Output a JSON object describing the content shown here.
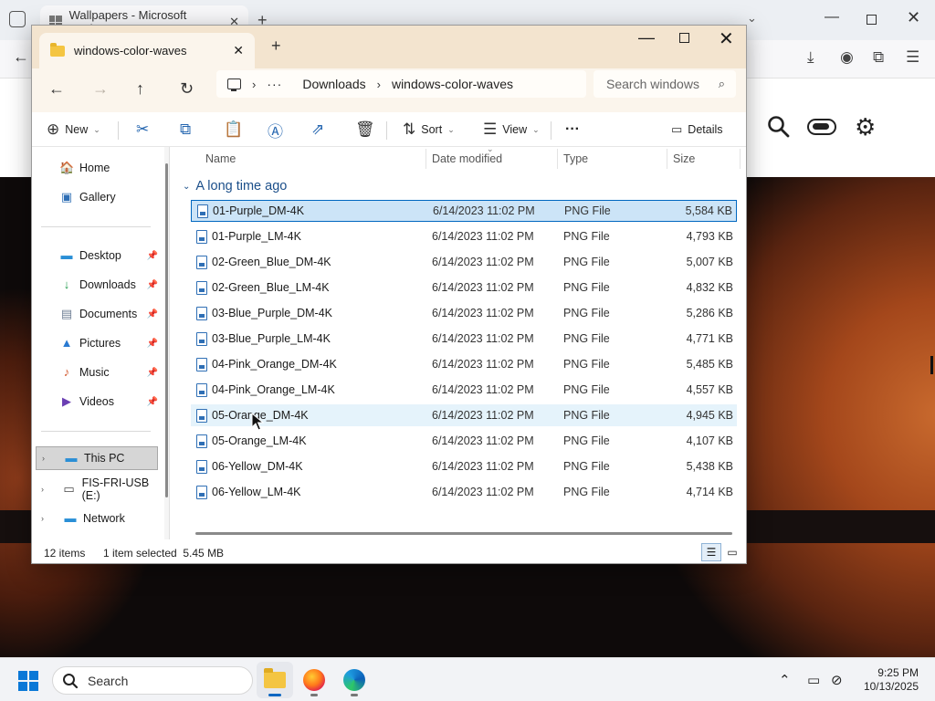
{
  "browser": {
    "tab_title": "Wallpapers - Microsoft Design",
    "tab_close": "✕",
    "new_tab": "+",
    "back": "←",
    "toolbar_icons": {
      "downloads": "download-icon",
      "account": "account-icon",
      "extensions": "extensions-icon",
      "menu": "menu-icon"
    }
  },
  "explorer": {
    "tab_title": "windows-color-waves",
    "tab_close": "✕",
    "new_tab": "+",
    "window_min": "—",
    "window_close": "✕",
    "nav": {
      "back": "←",
      "forward": "→",
      "up": "↑",
      "refresh": "↻"
    },
    "address": {
      "more": "···",
      "crumbs": [
        "Downloads",
        "windows-color-waves"
      ],
      "sep": "›"
    },
    "search_placeholder": "Search windows",
    "commands": {
      "new": "New",
      "sort": "Sort",
      "view": "View",
      "more": "···",
      "details": "Details"
    },
    "sidebar": {
      "home": "Home",
      "gallery": "Gallery",
      "pinned": [
        "Desktop",
        "Downloads",
        "Documents",
        "Pictures",
        "Music",
        "Videos"
      ],
      "this_pc": "This PC",
      "usb": "FIS-FRI-USB (E:)",
      "network": "Network"
    },
    "columns": {
      "name": "Name",
      "date": "Date modified",
      "type": "Type",
      "size": "Size"
    },
    "group": "A long time ago",
    "files": [
      {
        "name": "01-Purple_DM-4K",
        "date": "6/14/2023 11:02 PM",
        "type": "PNG File",
        "size": "5,584 KB"
      },
      {
        "name": "01-Purple_LM-4K",
        "date": "6/14/2023 11:02 PM",
        "type": "PNG File",
        "size": "4,793 KB"
      },
      {
        "name": "02-Green_Blue_DM-4K",
        "date": "6/14/2023 11:02 PM",
        "type": "PNG File",
        "size": "5,007 KB"
      },
      {
        "name": "02-Green_Blue_LM-4K",
        "date": "6/14/2023 11:02 PM",
        "type": "PNG File",
        "size": "4,832 KB"
      },
      {
        "name": "03-Blue_Purple_DM-4K",
        "date": "6/14/2023 11:02 PM",
        "type": "PNG File",
        "size": "5,286 KB"
      },
      {
        "name": "03-Blue_Purple_LM-4K",
        "date": "6/14/2023 11:02 PM",
        "type": "PNG File",
        "size": "4,771 KB"
      },
      {
        "name": "04-Pink_Orange_DM-4K",
        "date": "6/14/2023 11:02 PM",
        "type": "PNG File",
        "size": "5,485 KB"
      },
      {
        "name": "04-Pink_Orange_LM-4K",
        "date": "6/14/2023 11:02 PM",
        "type": "PNG File",
        "size": "4,557 KB"
      },
      {
        "name": "05-Orange_DM-4K",
        "date": "6/14/2023 11:02 PM",
        "type": "PNG File",
        "size": "4,945 KB"
      },
      {
        "name": "05-Orange_LM-4K",
        "date": "6/14/2023 11:02 PM",
        "type": "PNG File",
        "size": "4,107 KB"
      },
      {
        "name": "06-Yellow_DM-4K",
        "date": "6/14/2023 11:02 PM",
        "type": "PNG File",
        "size": "5,438 KB"
      },
      {
        "name": "06-Yellow_LM-4K",
        "date": "6/14/2023 11:02 PM",
        "type": "PNG File",
        "size": "4,714 KB"
      }
    ],
    "status": {
      "count": "12 items",
      "selection": "1 item selected  5.45 MB"
    }
  },
  "taskbar": {
    "search_placeholder": "Search",
    "time": "9:25 PM",
    "date": "10/13/2025"
  },
  "colors": {
    "explorer_title": "#f3e4cf",
    "explorer_nav": "#fbf5ec",
    "selection": "#cce4f7",
    "selection_border": "#0067c0",
    "accent": "#0a78d7"
  }
}
